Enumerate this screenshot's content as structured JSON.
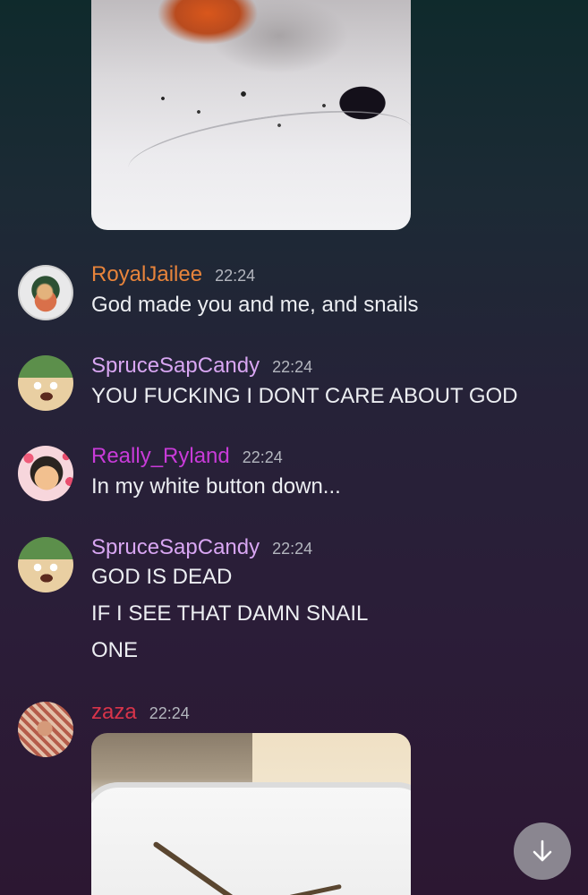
{
  "colors": {
    "royal": "#e8843b",
    "spruce": "#d8a6f2",
    "ryland": "#c83bd8",
    "zaza": "#d8344a",
    "text": "#eceef2",
    "timestamp": "#b3b6be"
  },
  "messages": [
    {
      "username": "RoyalJailee",
      "time": "22:24",
      "lines": [
        "God made you and me, and snails"
      ]
    },
    {
      "username": "SpruceSapCandy",
      "time": "22:24",
      "lines": [
        "YOU FUCKING I DONT CARE ABOUT GOD"
      ]
    },
    {
      "username": "Really_Ryland",
      "time": "22:24",
      "lines": [
        "In my white button down..."
      ]
    },
    {
      "username": "SpruceSapCandy",
      "time": "22:24",
      "lines": [
        "GOD IS DEAD",
        "IF I SEE THAT DAMN SNAIL",
        "ONE"
      ]
    },
    {
      "username": "zaza",
      "time": "22:24",
      "lines": []
    }
  ],
  "icons": {
    "scroll_down": "arrow-down-icon"
  }
}
